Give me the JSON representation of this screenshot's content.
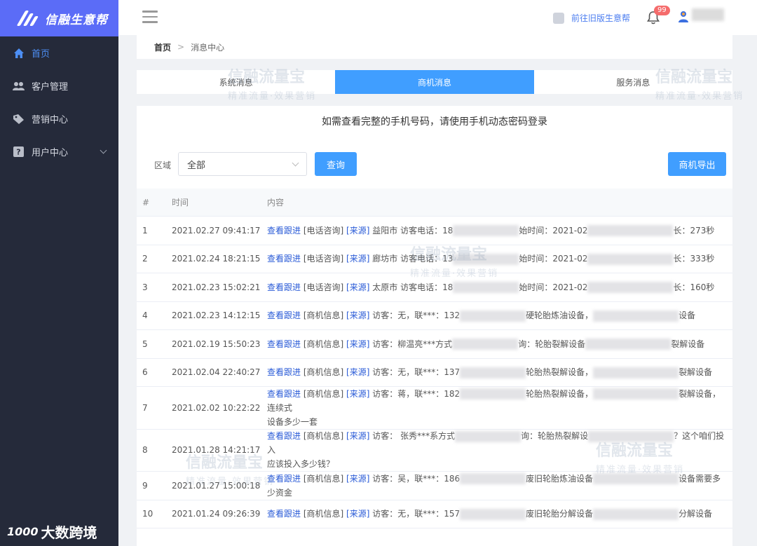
{
  "brand": {
    "name": "信融生意帮"
  },
  "sidebar": {
    "items": [
      {
        "label": "首页",
        "icon": "home-icon",
        "active": true
      },
      {
        "label": "客户管理",
        "icon": "users-icon"
      },
      {
        "label": "营销中心",
        "icon": "tag-icon"
      },
      {
        "label": "用户中心",
        "icon": "help-icon",
        "expandable": true
      }
    ]
  },
  "header": {
    "old_version_link": "前往旧版生意帮",
    "notification_count": "99"
  },
  "breadcrumb": {
    "home": "首页",
    "separator": ">",
    "current": "消息中心"
  },
  "tabs": [
    {
      "label": "系统消息"
    },
    {
      "label": "商机消息",
      "active": true
    },
    {
      "label": "服务消息"
    }
  ],
  "notice": "如需查看完整的手机号码，请使用手机动态密码登录",
  "filter": {
    "label": "区域",
    "value": "全部",
    "query_button": "查询",
    "export_button": "商机导出"
  },
  "table": {
    "headers": {
      "idx": "#",
      "time": "时间",
      "content": "内容"
    },
    "rows": [
      {
        "idx": "1",
        "time": "2021.02.27 09:41:17",
        "link": "查看跟进",
        "type": "[电话咨询]",
        "src": "[来源]",
        "text1": "益阳市 访客电话：18",
        "text2": "始时间：2021-02",
        "text3": "长：273秒"
      },
      {
        "idx": "2",
        "time": "2021.02.24 18:21:15",
        "link": "查看跟进",
        "type": "[电话咨询]",
        "src": "[来源]",
        "text1": "廊坊市 访客电话：13",
        "text2": "始时间：2021-02",
        "text3": "长：333秒"
      },
      {
        "idx": "3",
        "time": "2021.02.23 15:02:21",
        "link": "查看跟进",
        "type": "[电话咨询]",
        "src": "[来源]",
        "text1": "太原市 访客电话：18",
        "text2": "始时间：2021-02",
        "text3": "长：160秒"
      },
      {
        "idx": "4",
        "time": "2021.02.23 14:12:15",
        "link": "查看跟进",
        "type": "[商机信息]",
        "src": "[来源]",
        "text1": "访客：无，联***：132",
        "text2": "硬轮胎炼油设备，",
        "text3": "设备"
      },
      {
        "idx": "5",
        "time": "2021.02.19 15:50:23",
        "link": "查看跟进",
        "type": "[商机信息]",
        "src": "[来源]",
        "text1": "访客：柳温亮***方式",
        "text2": "询：轮胎裂解设备",
        "text3": "裂解设备"
      },
      {
        "idx": "6",
        "time": "2021.02.04 22:40:27",
        "link": "查看跟进",
        "type": "[商机信息]",
        "src": "[来源]",
        "text1": "访客：无，联***：137",
        "text2": "轮胎热裂解设备，",
        "text3": "裂解设备"
      },
      {
        "idx": "7",
        "time": "2021.02.02 10:22:22",
        "link": "查看跟进",
        "type": "[商机信息]",
        "src": "[来源]",
        "text1": "访客：蒋，联***：182",
        "text2": "轮胎热裂解设备，",
        "text3": "裂解设备，连续式",
        "text4": "设备多少一套",
        "tall": true
      },
      {
        "idx": "8",
        "time": "2021.01.28 14:21:17",
        "link": "查看跟进",
        "type": "[商机信息]",
        "src": "[来源]",
        "text1": "访客： 张秀***系方式",
        "text2": "询：轮胎热裂解设",
        "text3": "？这个咱们投入",
        "text4": "应该投入多少钱？",
        "tall": true
      },
      {
        "idx": "9",
        "time": "2021.01.27 15:00:18",
        "link": "查看跟进",
        "type": "[商机信息]",
        "src": "[来源]",
        "text1": "访客：吴，联***：186",
        "text2": "废旧轮胎炼油设备",
        "text3": "设备需要多少资金"
      },
      {
        "idx": "10",
        "time": "2021.01.24 09:26:39",
        "link": "查看跟进",
        "type": "[商机信息]",
        "src": "[来源]",
        "text1": "访客：无，联***：157",
        "text2": "废旧轮胎分解设备",
        "text3": "分解设备"
      }
    ]
  },
  "watermark": {
    "title": "信融流量宝",
    "subtitle": "精准流量·效果营销"
  },
  "footer": {
    "mark": "1000",
    "label": "大数跨境"
  },
  "colors": {
    "primary": "#409eff",
    "sidebar_bg": "#252a3a",
    "logo_bg": "#5b6cf7",
    "link": "#2a5bd7"
  }
}
